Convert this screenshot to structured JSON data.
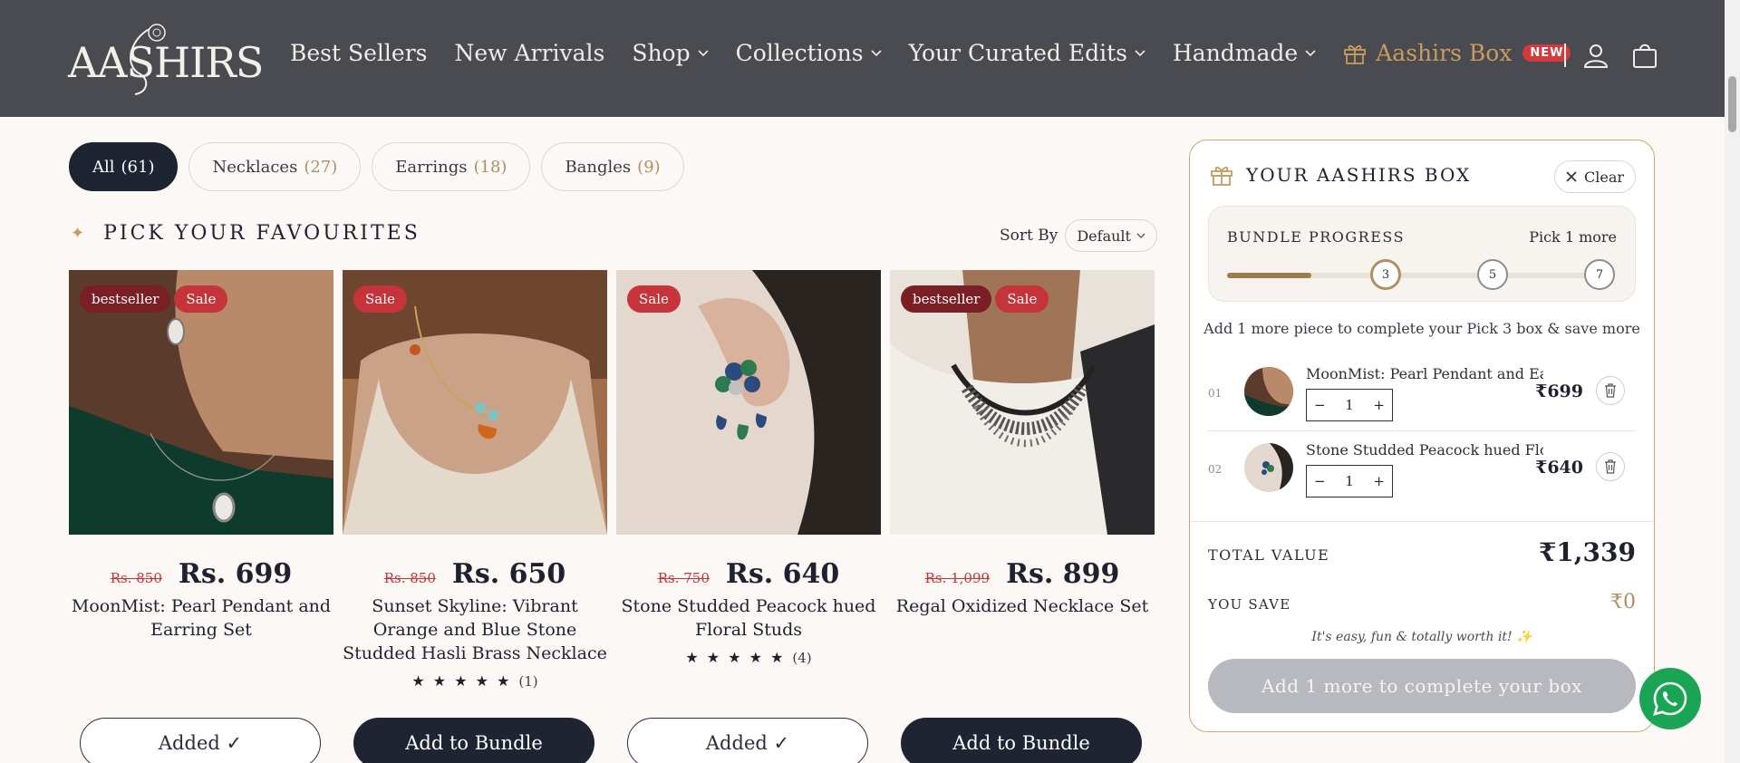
{
  "header": {
    "logo": "AASHIRS",
    "nav": [
      {
        "label": "Best Sellers",
        "dropdown": false
      },
      {
        "label": "New Arrivals",
        "dropdown": false
      },
      {
        "label": "Shop",
        "dropdown": true
      },
      {
        "label": "Collections",
        "dropdown": true
      },
      {
        "label": "Your Curated Edits",
        "dropdown": true
      },
      {
        "label": "Handmade",
        "dropdown": true
      }
    ],
    "box_link": "Aashirs Box",
    "new_badge": "NEW",
    "icons": [
      "account-icon",
      "cart-icon"
    ]
  },
  "filters": [
    {
      "label": "All",
      "count": "(61)",
      "active": true
    },
    {
      "label": "Necklaces",
      "count": "(27)",
      "active": false
    },
    {
      "label": "Earrings",
      "count": "(18)",
      "active": false
    },
    {
      "label": "Bangles",
      "count": "(9)",
      "active": false
    }
  ],
  "section_title": "PICK YOUR FAVOURITES",
  "sort": {
    "label": "Sort By",
    "value": "Default"
  },
  "products": [
    {
      "badges": [
        "bestseller",
        "Sale"
      ],
      "old_price": "Rs. 850",
      "price": "Rs. 699",
      "name": "MoonMist: Pearl Pendant and Earring Set",
      "stars": "",
      "reviews": "",
      "button": "Added ✓",
      "added": true
    },
    {
      "badges": [
        "Sale"
      ],
      "old_price": "Rs. 850",
      "price": "Rs. 650",
      "name": "Sunset Skyline: Vibrant Orange and Blue Stone Studded Hasli Brass Necklace",
      "stars": "★ ★ ★ ★ ★",
      "reviews": "(1)",
      "button": "Add to Bundle",
      "added": false
    },
    {
      "badges": [
        "Sale"
      ],
      "old_price": "Rs. 750",
      "price": "Rs. 640",
      "name": "Stone Studded Peacock hued Floral Studs",
      "stars": "★ ★ ★ ★ ★",
      "reviews": "(4)",
      "button": "Added ✓",
      "added": true
    },
    {
      "badges": [
        "bestseller",
        "Sale"
      ],
      "old_price": "Rs. 1,099",
      "price": "Rs. 899",
      "name": "Regal Oxidized Necklace Set",
      "stars": "",
      "reviews": "",
      "button": "Add to Bundle",
      "added": false
    }
  ],
  "box": {
    "title": "YOUR AASHIRS BOX",
    "clear": "Clear",
    "progress_label": "BUNDLE PROGRESS",
    "progress_more": "Pick 1 more",
    "progress_fraction": 0.22,
    "steps": [
      "3",
      "5",
      "7"
    ],
    "hint": "Add 1 more piece to complete your Pick 3 box & save more",
    "items": [
      {
        "idx": "01",
        "name": "MoonMist: Pearl Pendant and Ear...",
        "qty": "1",
        "price": "₹699"
      },
      {
        "idx": "02",
        "name": "Stone Studded Peacock hued Flor...",
        "qty": "1",
        "price": "₹640"
      }
    ],
    "total_label": "TOTAL VALUE",
    "total_value": "₹1,339",
    "save_label": "YOU SAVE",
    "save_value": "₹0",
    "tagline": "It's easy, fun & totally worth it! ✨",
    "cta": "Add 1 more to complete your box"
  },
  "colors": {
    "header": "#4a4b51",
    "accent": "#c79d5c",
    "dark": "#1f2433",
    "sale": "#c5343a",
    "bestseller": "#7a1f25",
    "whatsapp": "#1aa554"
  }
}
